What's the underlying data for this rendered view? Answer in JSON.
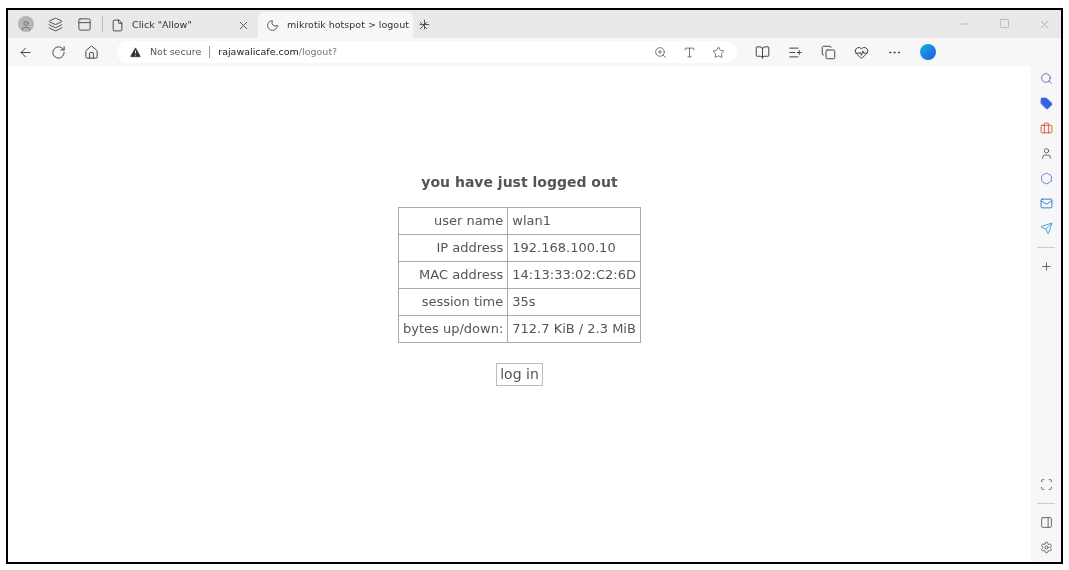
{
  "tabs": [
    {
      "title": "Click \"Allow\"",
      "selected": false
    },
    {
      "title": "mikrotik hotspot > logout",
      "selected": true
    }
  ],
  "address_bar": {
    "security": "Not secure",
    "host": "rajawalicafe.com",
    "path": "/logout?"
  },
  "page": {
    "heading": "you have just logged out",
    "rows": [
      {
        "label": "user name",
        "value": "wlan1"
      },
      {
        "label": "IP address",
        "value": "192.168.100.10"
      },
      {
        "label": "MAC address",
        "value": "14:13:33:02:C2:6D"
      },
      {
        "label": "session time",
        "value": "35s"
      },
      {
        "label": "bytes up/down:",
        "value": "712.7 KiB / 2.3 MiB"
      }
    ],
    "button": "log in"
  }
}
